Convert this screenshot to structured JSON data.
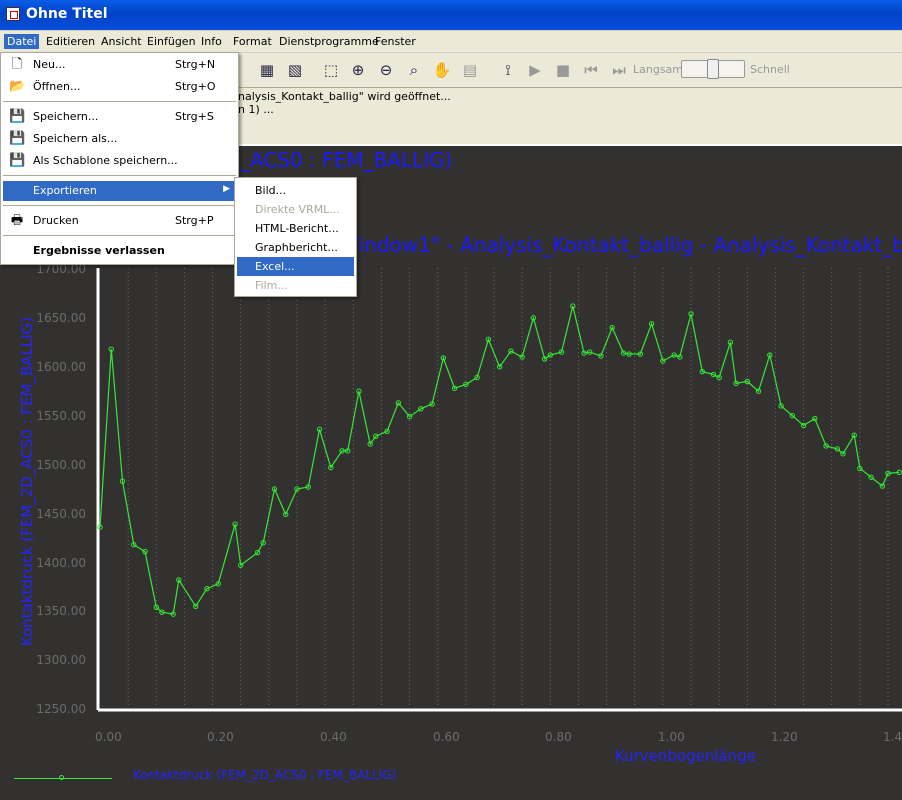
{
  "window": {
    "title": "Ohne Titel"
  },
  "menubar": [
    "Datei",
    "Editieren",
    "Ansicht",
    "Einfügen",
    "Info",
    "Format",
    "Dienstprogramme",
    "Fenster"
  ],
  "toolbar": {
    "slow_label": "Langsam",
    "fast_label": "Schnell",
    "speed_level": 0.5
  },
  "messages": {
    "line1": "nalysis_Kontakt_ballig\" wird geöffnet...",
    "line2": "n 1) ..."
  },
  "file_menu": {
    "items": [
      {
        "label": "Neu...",
        "shortcut": "Strg+N",
        "icon": "new-doc-icon"
      },
      {
        "label": "Öffnen...",
        "shortcut": "Strg+O",
        "icon": "open-folder-icon"
      },
      {
        "label": "Speichern...",
        "shortcut": "Strg+S",
        "icon": "save-icon"
      },
      {
        "label": "Speichern als...",
        "shortcut": "",
        "icon": "save-as-icon"
      },
      {
        "label": "Als Schablone speichern...",
        "shortcut": "",
        "icon": "save-template-icon"
      },
      {
        "label": "Exportieren",
        "shortcut": "",
        "icon": ""
      },
      {
        "label": "Drucken",
        "shortcut": "Strg+P",
        "icon": "print-icon"
      },
      {
        "label": "Ergebnisse verlassen",
        "shortcut": "",
        "icon": ""
      }
    ]
  },
  "export_submenu": [
    "Bild...",
    "Direkte VRML...",
    "HTML-Bericht...",
    "Graphbericht...",
    "Excel...",
    "Film..."
  ],
  "plot": {
    "title_top": "_ACS0 : FEM_BALLIG)",
    "title_mid": "/indow1\" - Analysis_Kontakt_ballig - Analysis_Kontakt_b",
    "legend": "Kontaktdruck (FEM_2D_ACS0 : FEM_BALLIG)"
  },
  "colors": {
    "series": "#35e835",
    "title_text": "#1a1aff",
    "plot_bg": "#333130",
    "selection": "#316ac5"
  },
  "chart_data": {
    "type": "line",
    "title": "",
    "xlabel": "Kurvenbogenlänge",
    "ylabel": "Kontaktdruck (FEM_2D_ACS0 : FEM_BALLIG)",
    "xlim": [
      -0.02,
      1.42
    ],
    "ylim": [
      1250,
      1700
    ],
    "grid": true,
    "x_ticks": [
      "0.00",
      "0.20",
      "0.40",
      "0.60",
      "0.80",
      "1.00",
      "1.20",
      "1.40"
    ],
    "y_ticks": [
      "1250.00",
      "1300.00",
      "1350.00",
      "1400.00",
      "1450.00",
      "1500.00",
      "1550.00",
      "1600.00",
      "1650.00",
      "1700.00"
    ],
    "series": [
      {
        "name": "Kontaktdruck (FEM_2D_ACS0 : FEM_BALLIG)",
        "x": [
          0.0,
          0.02,
          0.04,
          0.06,
          0.08,
          0.1,
          0.11,
          0.13,
          0.14,
          0.17,
          0.19,
          0.21,
          0.24,
          0.25,
          0.28,
          0.29,
          0.31,
          0.33,
          0.35,
          0.37,
          0.39,
          0.41,
          0.43,
          0.44,
          0.46,
          0.48,
          0.49,
          0.51,
          0.53,
          0.55,
          0.57,
          0.59,
          0.61,
          0.63,
          0.65,
          0.67,
          0.69,
          0.71,
          0.73,
          0.75,
          0.77,
          0.79,
          0.8,
          0.82,
          0.84,
          0.86,
          0.87,
          0.89,
          0.91,
          0.93,
          0.94,
          0.96,
          0.98,
          1.0,
          1.02,
          1.03,
          1.05,
          1.07,
          1.09,
          1.1,
          1.12,
          1.13,
          1.15,
          1.17,
          1.19,
          1.21,
          1.23,
          1.25,
          1.27,
          1.29,
          1.31,
          1.32,
          1.34,
          1.35,
          1.37,
          1.39,
          1.4,
          1.42
        ],
        "y": [
          1435,
          1617,
          1482,
          1417,
          1410,
          1353,
          1348,
          1346,
          1381,
          1354,
          1372,
          1377,
          1438,
          1396,
          1409,
          1419,
          1474,
          1448,
          1474,
          1476,
          1535,
          1496,
          1513,
          1513,
          1574,
          1520,
          1528,
          1533,
          1562,
          1548,
          1556,
          1561,
          1608,
          1577,
          1581,
          1588,
          1627,
          1599,
          1615,
          1609,
          1649,
          1607,
          1611,
          1614,
          1661,
          1613,
          1614,
          1610,
          1639,
          1613,
          1612,
          1612,
          1643,
          1605,
          1611,
          1609,
          1653,
          1594,
          1591,
          1588,
          1624,
          1582,
          1584,
          1574,
          1611,
          1559,
          1549,
          1539,
          1546,
          1518,
          1515,
          1510,
          1529,
          1495,
          1486,
          1477,
          1490,
          1491
        ]
      }
    ]
  }
}
